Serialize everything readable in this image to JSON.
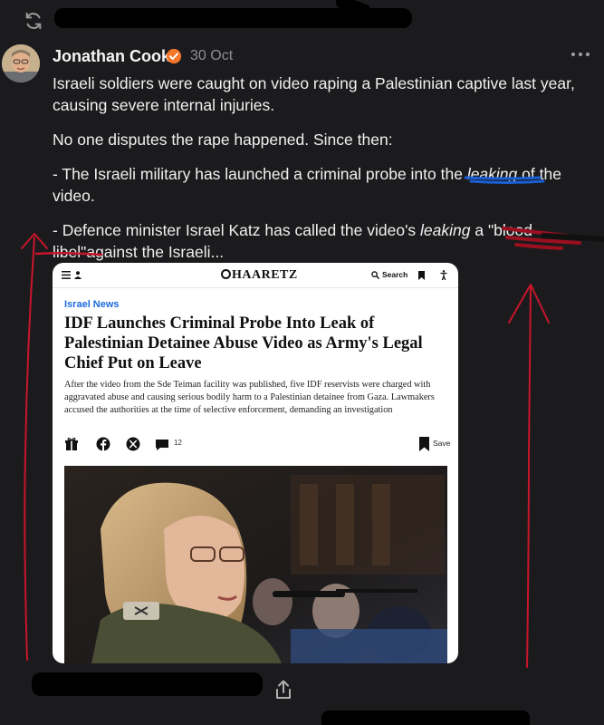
{
  "topbar": {
    "refresh_icon": "refresh-icon"
  },
  "post": {
    "author": "Jonathan Cook",
    "verified_icon": "verified-badge-icon",
    "date": "30 Oct",
    "more_icon": "more-dots-icon",
    "paragraphs": {
      "p1": "Israeli soldiers were caught on video raping a Palestinian captive last year, causing severe internal injuries.",
      "p2": "No one disputes the rape happened. Since then:",
      "p3_before": "- The Israeli military has launched a criminal probe into the ",
      "p3_em": "leaking",
      "p3_after": " of the video.",
      "p4_before": "- Defence minister Israel Katz has called the video's ",
      "p4_em": "leaking",
      "p4_after": " a \"blood libel\"against the Israeli..."
    }
  },
  "card": {
    "logo": "HAARETZ",
    "search_label": "Search",
    "section": "Israel News",
    "headline": "IDF Launches Criminal Probe Into Leak of Palestinian Detainee Abuse Video as Army's Legal Chief Put on Leave",
    "summary": "After the video from the Sde Teiman facility was published, five IDF reservists were charged with aggravated abuse and causing serious bodily harm to a Palestinian detainee from Gaza. Lawmakers accused the authorities at the time of selective enforcement, demanding an investigation",
    "comment_count": "12",
    "save_label": "Save"
  },
  "colors": {
    "accent_blue": "#1d6ae0",
    "annotation_red": "#c8162b",
    "annotation_blue": "#1a5fd6",
    "verified_orange": "#f4762a"
  }
}
